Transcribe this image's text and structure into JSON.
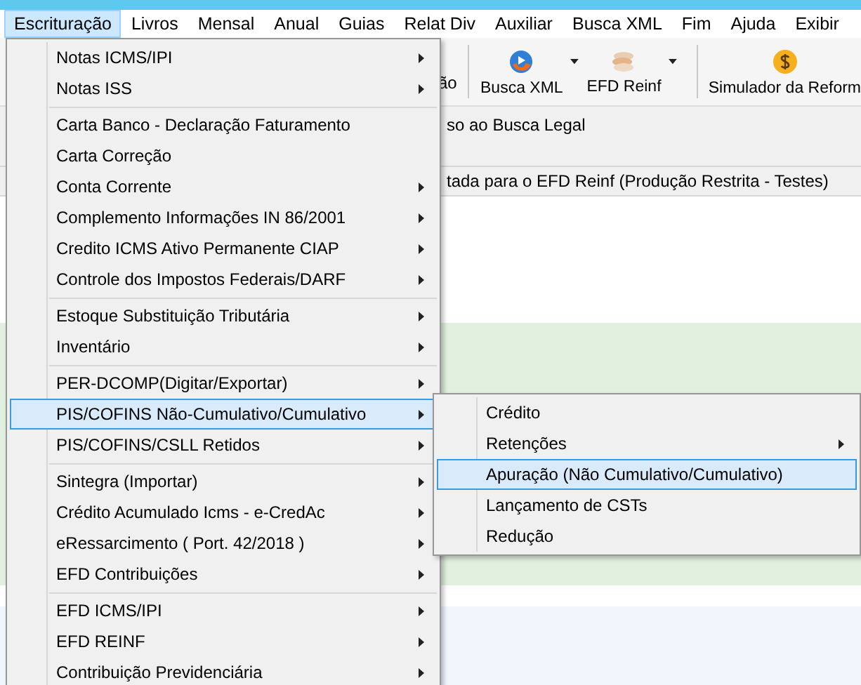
{
  "menubar": [
    {
      "label": "Escrituração",
      "selected": true
    },
    {
      "label": "Livros",
      "selected": false
    },
    {
      "label": "Mensal",
      "selected": false
    },
    {
      "label": "Anual",
      "selected": false
    },
    {
      "label": "Guias",
      "selected": false
    },
    {
      "label": "Relat Div",
      "selected": false
    },
    {
      "label": "Auxiliar",
      "selected": false
    },
    {
      "label": "Busca XML",
      "selected": false
    },
    {
      "label": "Fim",
      "selected": false
    },
    {
      "label": "Ajuda",
      "selected": false
    },
    {
      "label": "Exibir",
      "selected": false
    }
  ],
  "toolbar": {
    "partial_label": "ão",
    "buttons": [
      {
        "kind": "xml",
        "label": "Busca XML",
        "dropdown": true
      },
      {
        "kind": "reinf",
        "label": "EFD Reinf",
        "dropdown": true
      },
      {
        "kind": "money",
        "label": "Simulador da Reform",
        "dropdown": false
      }
    ]
  },
  "info_lines": [
    "so ao Busca Legal",
    "tada para o EFD Reinf (Produção Restrita - Testes)"
  ],
  "menu": [
    {
      "kind": "item",
      "label": "Notas ICMS/IPI",
      "submenu": true,
      "selected": false
    },
    {
      "kind": "item",
      "label": "Notas ISS",
      "submenu": true,
      "selected": false
    },
    {
      "kind": "separator"
    },
    {
      "kind": "item",
      "label": "Carta Banco - Declaração Faturamento",
      "submenu": false,
      "selected": false
    },
    {
      "kind": "item",
      "label": "Carta Correção",
      "submenu": false,
      "selected": false
    },
    {
      "kind": "item",
      "label": "Conta Corrente",
      "submenu": true,
      "selected": false
    },
    {
      "kind": "item",
      "label": "Complemento Informações IN 86/2001",
      "submenu": true,
      "selected": false
    },
    {
      "kind": "item",
      "label": "Credito ICMS Ativo Permanente CIAP",
      "submenu": true,
      "selected": false
    },
    {
      "kind": "item",
      "label": "Controle dos Impostos Federais/DARF",
      "submenu": true,
      "selected": false
    },
    {
      "kind": "separator"
    },
    {
      "kind": "item",
      "label": "Estoque Substituição Tributária",
      "submenu": true,
      "selected": false
    },
    {
      "kind": "item",
      "label": "Inventário",
      "submenu": true,
      "selected": false
    },
    {
      "kind": "separator"
    },
    {
      "kind": "item",
      "label": "PER-DCOMP(Digitar/Exportar)",
      "submenu": true,
      "selected": false
    },
    {
      "kind": "item",
      "label": "PIS/COFINS Não-Cumulativo/Cumulativo",
      "submenu": true,
      "selected": true
    },
    {
      "kind": "item",
      "label": "PIS/COFINS/CSLL Retidos",
      "submenu": true,
      "selected": false
    },
    {
      "kind": "separator"
    },
    {
      "kind": "item",
      "label": "Sintegra (Importar)",
      "submenu": true,
      "selected": false
    },
    {
      "kind": "item",
      "label": "Crédito Acumulado Icms - e-CredAc",
      "submenu": true,
      "selected": false
    },
    {
      "kind": "item",
      "label": "eRessarcimento ( Port. 42/2018 )",
      "submenu": true,
      "selected": false
    },
    {
      "kind": "item",
      "label": "EFD Contribuições",
      "submenu": true,
      "selected": false
    },
    {
      "kind": "separator"
    },
    {
      "kind": "item",
      "label": "EFD ICMS/IPI",
      "submenu": true,
      "selected": false
    },
    {
      "kind": "item",
      "label": "EFD REINF",
      "submenu": true,
      "selected": false
    },
    {
      "kind": "item",
      "label": "Contribuição Previdenciária",
      "submenu": true,
      "selected": false
    }
  ],
  "submenu": [
    {
      "kind": "item",
      "label": "Crédito",
      "submenu": false,
      "selected": false
    },
    {
      "kind": "item",
      "label": "Retenções",
      "submenu": true,
      "selected": false
    },
    {
      "kind": "item",
      "label": "Apuração (Não Cumulativo/Cumulativo)",
      "submenu": false,
      "selected": true
    },
    {
      "kind": "item",
      "label": "Lançamento de CSTs",
      "submenu": false,
      "selected": false
    },
    {
      "kind": "item",
      "label": "Redução",
      "submenu": false,
      "selected": false
    }
  ]
}
